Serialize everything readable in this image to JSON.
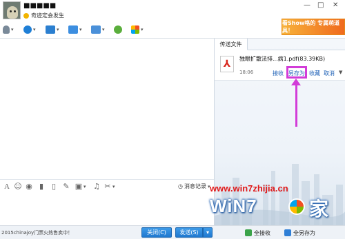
{
  "header": {
    "contact_name": "■■■■■",
    "status_text": "奇迹定会发生",
    "window_controls": [
      "—",
      "□",
      "✕"
    ]
  },
  "toolbar": {
    "icons": [
      "microphone-icon",
      "video-icon",
      "screen-share-icon",
      "folder-icon",
      "remote-desktop-icon",
      "add-contact-icon",
      "apps-icon"
    ]
  },
  "ad_banner": {
    "text": "看Show咯的 专属萌道具！"
  },
  "side_panel": {
    "tab_label": "传送文件",
    "file": {
      "name": "独眼扩散法排...病1.pdf(83.39KB)",
      "time": "18:06",
      "actions": {
        "receive": "接收",
        "save_as": "另存为",
        "favorite": "收藏",
        "cancel": "取消"
      }
    }
  },
  "input_toolbar": {
    "icons": [
      "font-icon",
      "emoji-icon",
      "nudge-icon",
      "voice-message-icon",
      "edit-icon",
      "image-icon",
      "music-icon",
      "screenshot-icon"
    ],
    "message_record_label": "消息记录"
  },
  "footer": {
    "ad_text": "2015chinajoy门票火热售卖中！",
    "close_label": "关闭(C)",
    "send_label": "发送(S)",
    "receive_all_label": "全接收",
    "save_all_label": "全另存为"
  },
  "watermark": {
    "url": "www.win7zhijia.cn",
    "logo": "WiN7",
    "suffix": "家"
  },
  "colors": {
    "highlight": "#d23cd8",
    "link": "#1a5eb5",
    "primary_button": "#1f78cf",
    "watermark_red": "#e0191a"
  }
}
